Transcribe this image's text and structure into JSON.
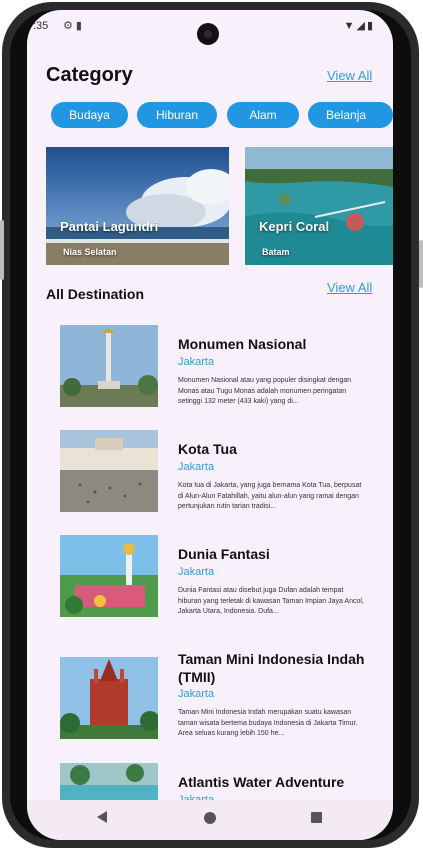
{
  "status_bar": {
    "time": ":35"
  },
  "category": {
    "title": "Category",
    "view_all": "View All",
    "chips": [
      "Budaya",
      "Hiburan",
      "Alam",
      "Belanja"
    ]
  },
  "featured": [
    {
      "title": "Pantai Lagundri",
      "location": "Nias Selatan"
    },
    {
      "title": "Kepri Coral",
      "location": "Batam"
    }
  ],
  "all_destination": {
    "title": "All Destination",
    "view_all": "View All",
    "items": [
      {
        "name": "Monumen Nasional",
        "city": "Jakarta",
        "desc": "Monumen Nasional atau yang populer disingkat dengan Monas atau Tugu Monas adalah monumen peringatan setinggi 132 meter (433 kaki) yang di..."
      },
      {
        "name": "Kota Tua",
        "city": "Jakarta",
        "desc": "Kota tua di Jakarta, yang juga bernama Kota Tua, berpusat di Alun-Alun Fatahillah, yaitu alun-alun yang ramai dengan pertunjukan rutin tarian tradisi..."
      },
      {
        "name": "Dunia Fantasi",
        "city": "Jakarta",
        "desc": "Dunia Fantasi atau disebut juga Dufan adalah tempat hiburan yang terletak di kawasan Taman Impian Jaya Ancol, Jakarta Utara, Indonesia. Dufa..."
      },
      {
        "name": "Taman Mini Indonesia Indah (TMII)",
        "city": "Jakarta",
        "desc": "Taman Mini Indonesia Indah merupakan suatu kawasan taman wisata bertema budaya Indonesia di Jakarta Timur. Area seluas kurang lebih 150 he..."
      },
      {
        "name": "Atlantis Water Adventure",
        "city": "Jakarta",
        "desc": ""
      }
    ]
  }
}
